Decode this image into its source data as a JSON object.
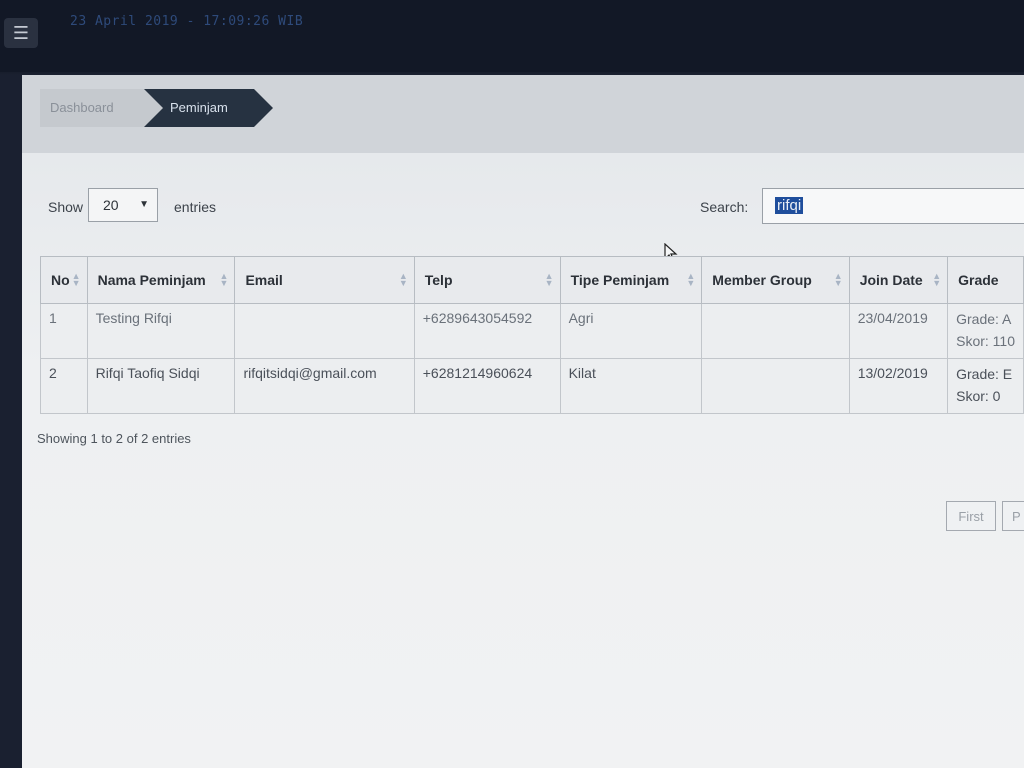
{
  "topbar": {
    "menu_icon": "hamburger-icon",
    "datetime": "23 April 2019 - 17:09:26 WIB"
  },
  "breadcrumb": {
    "items": [
      {
        "label": "Dashboard"
      },
      {
        "label": "Peminjam"
      }
    ]
  },
  "controls": {
    "show_label": "Show",
    "page_size": "20",
    "entries_label": "entries",
    "search_label": "Search:",
    "search_value": "rifqi"
  },
  "table": {
    "columns": [
      "No",
      "Nama Peminjam",
      "Email",
      "Telp",
      "Tipe Peminjam",
      "Member Group",
      "Join Date",
      "Grade"
    ],
    "rows": [
      {
        "no": "1",
        "nama": "Testing Rifqi",
        "email": "",
        "telp": "+6289643054592",
        "tipe": "Agri",
        "member_group": "",
        "join_date": "23/04/2019",
        "grade_line1": "Grade: A",
        "grade_line2": "Skor: 110"
      },
      {
        "no": "2",
        "nama": "Rifqi Taofiq Sidqi",
        "email": "rifqitsidqi@gmail.com",
        "telp": "+6281214960624",
        "tipe": "Kilat",
        "member_group": "",
        "join_date": "13/02/2019",
        "grade_line1": "Grade: E",
        "grade_line2": "Skor: 0"
      }
    ]
  },
  "footer": {
    "showing_text": "Showing 1 to 2 of 2 entries"
  },
  "pagination": {
    "first_label": "First",
    "prev_label": "P"
  }
}
